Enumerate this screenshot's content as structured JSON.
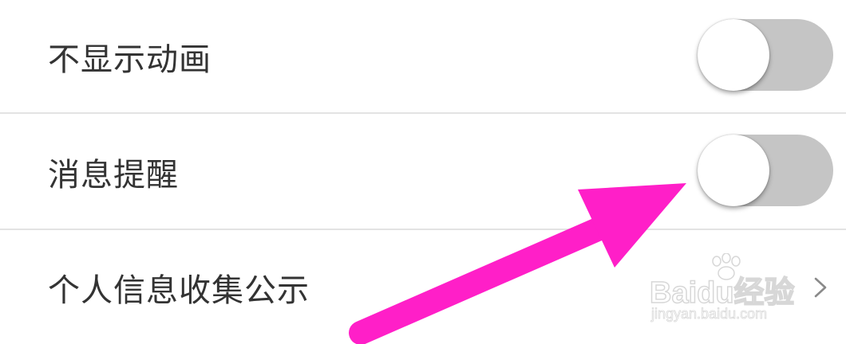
{
  "settings": {
    "items": [
      {
        "label": "不显示动画",
        "control": "toggle",
        "state": "off"
      },
      {
        "label": "消息提醒",
        "control": "toggle",
        "state": "off"
      },
      {
        "label": "个人信息收集公示",
        "control": "chevron"
      }
    ]
  },
  "watermark": {
    "logo": "Baidu经验",
    "sub": "jingyan.baidu.com"
  },
  "colors": {
    "toggle_track_off": "#c5c5c5",
    "arrow": "#ff1fc8",
    "text": "#333333",
    "divider": "#e3e3e3"
  },
  "icons": {
    "chevron": "chevron-right-icon",
    "watermark_paw": "paw-icon"
  }
}
